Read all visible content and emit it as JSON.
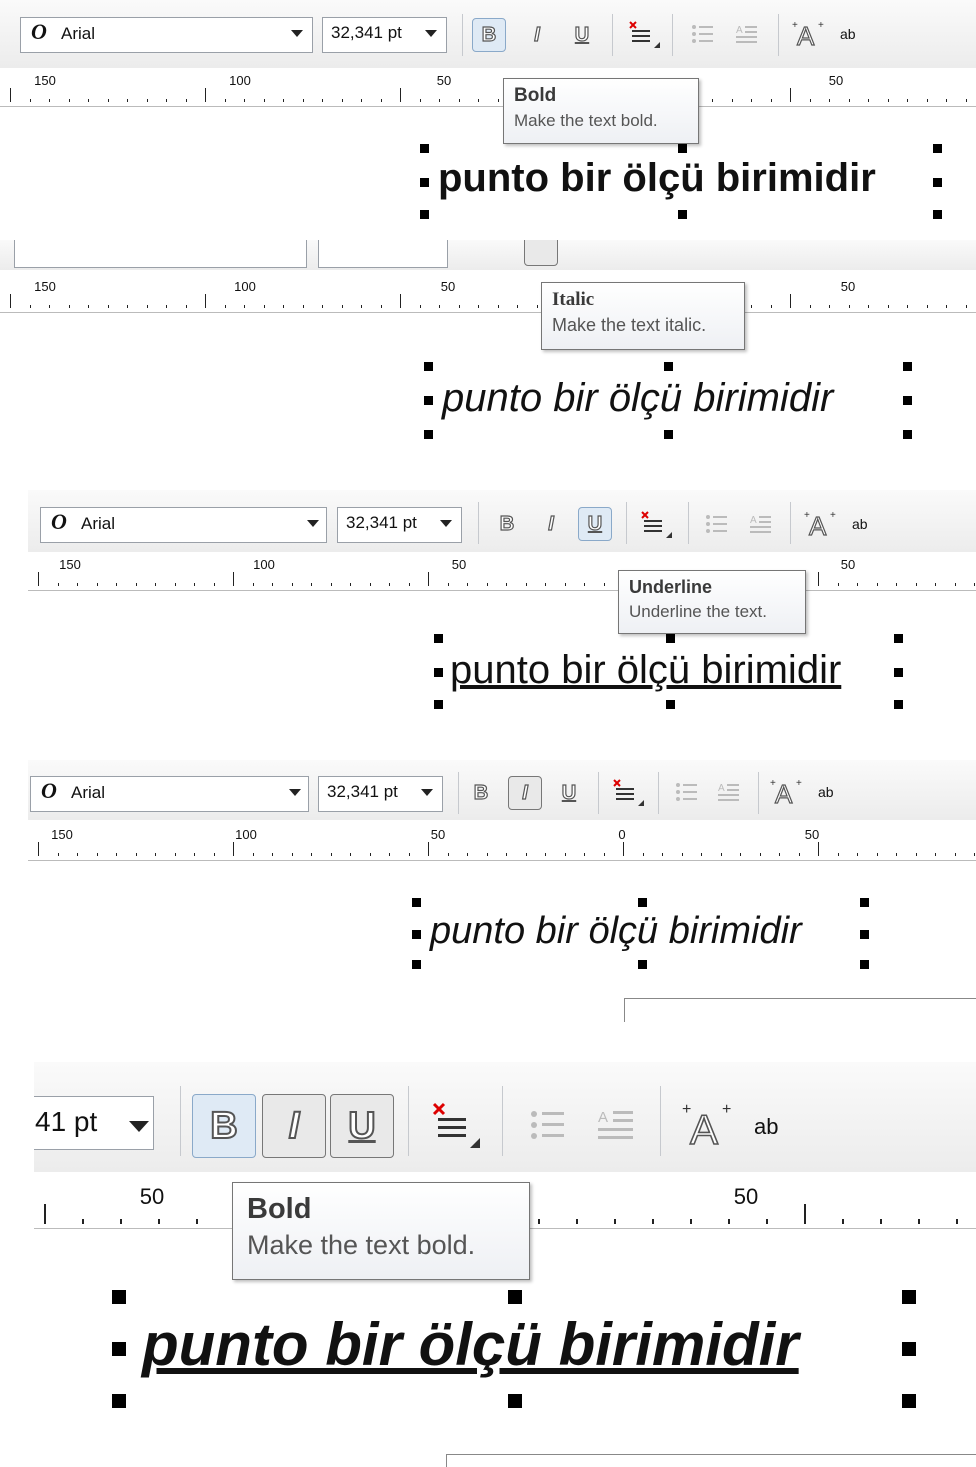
{
  "colors": {
    "toolbar_bg": "#ececec",
    "active_button": "#dfeaf5",
    "tooltip_border": "#767676"
  },
  "toolbar": {
    "font_icon": "O",
    "font_name": "Arial",
    "font_size": "32,341 pt",
    "font_size_partial": "41 pt",
    "bold_glyph": "B",
    "italic_glyph": "I",
    "underline_glyph": "U",
    "text_icon_label": "ab",
    "icons": [
      "bold-icon",
      "italic-icon",
      "underline-icon",
      "insert-symbol-icon",
      "bullet-list-icon",
      "drop-cap-icon",
      "text-properties-icon",
      "edit-text-icon"
    ]
  },
  "ruler": {
    "labels": [
      "150",
      "100",
      "50",
      "0",
      "50"
    ]
  },
  "sample_text": "punto bir ölçü birimidir",
  "panels": [
    {
      "title": "bold",
      "tooltip": {
        "title": "Bold",
        "description": "Make the text bold."
      }
    },
    {
      "title": "italic",
      "tooltip": {
        "title": "Italic",
        "description": "Make the text italic."
      }
    },
    {
      "title": "underline",
      "tooltip": {
        "title": "Underline",
        "description": "Underline the text."
      }
    },
    {
      "title": "italic-no-tooltip"
    },
    {
      "title": "bold-italic-underline",
      "tooltip": {
        "title": "Bold",
        "description": "Make the text bold."
      }
    }
  ]
}
